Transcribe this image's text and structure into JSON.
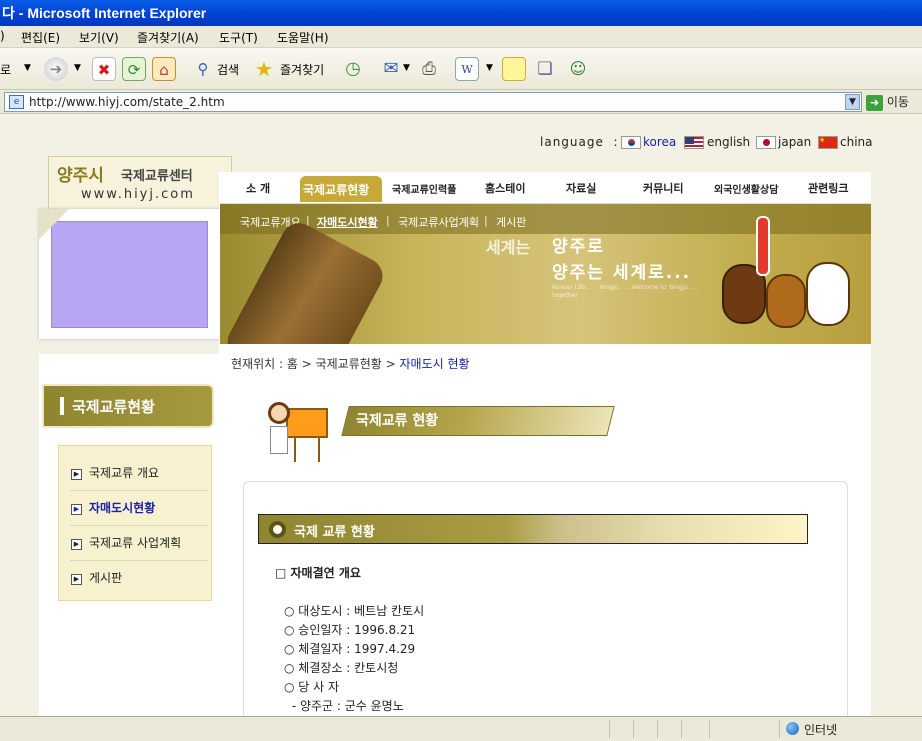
{
  "window": {
    "title": "다 - Microsoft Internet Explorer"
  },
  "menu": {
    "file": ")",
    "edit": "편집(E)",
    "view": "보기(V)",
    "favorites": "즐겨찾기(A)",
    "tools": "도구(T)",
    "help": "도움말(H)"
  },
  "toolbar": {
    "back_label": "로",
    "search_label": "검색",
    "favorites_label": "즐겨찾기"
  },
  "address": {
    "url": "http://www.hiyj.com/state_2.htm",
    "go_label": "이동"
  },
  "site": {
    "language_label": "language  :",
    "languages": [
      "korea",
      "english",
      "japan",
      "china"
    ],
    "logo_main": "양주시",
    "logo_sub": "국제교류센터",
    "logo_url": "www.hiyj.com",
    "gnb": [
      "소 개",
      "국제교류현황",
      "국제교류인력풀",
      "홈스테이",
      "자료실",
      "커뮤니티",
      "외국인생활상담",
      "관련링크"
    ],
    "subnav": [
      "국제교류개요",
      "자매도시현황",
      "국제교류사업계획",
      "게시판"
    ],
    "banner_line1": "양주로",
    "banner_line2": "양주는 세계로...",
    "banner_left": "세계는",
    "banner_en": "Korean Life . . . Yangju . . . welcome to Yangju . . . together",
    "breadcrumb_prefix": "현재위치 : 홈 > 국제교류현황 >",
    "breadcrumb_current": "자매도시 현황",
    "lnb_title": "국제교류현황",
    "lnb_items": [
      "국제교류 개요",
      "자매도시현황",
      "국제교류 사업계획",
      "게시판"
    ],
    "page_title": "국제교류 현황",
    "section_title": "국제 교류 현황",
    "subsection": "□ 자매결연 개요",
    "info": [
      "○ 대상도시 : 베트남 칸토시",
      "○ 승인일자 : 1996.8.21",
      "○ 체결일자 : 1997.4.29",
      "○ 체결장소 : 칸토시청",
      "○ 당 사 자",
      " - 양주군 : 군수 윤명노"
    ]
  },
  "status": {
    "zone": "인터넷"
  },
  "colors": {
    "accent": "#b8a04a",
    "olive": "#8f8530",
    "lavender": "#b8a6f5",
    "active": "#1a22a8"
  }
}
